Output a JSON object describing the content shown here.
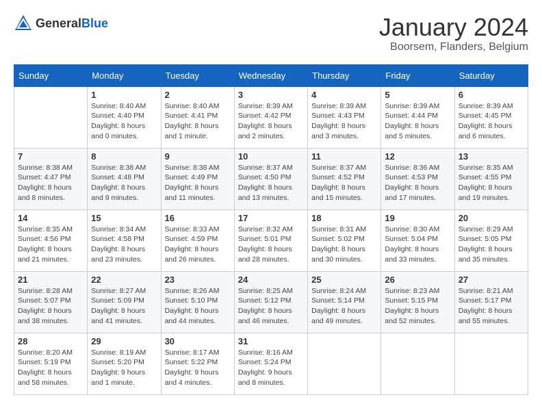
{
  "header": {
    "logo_general": "General",
    "logo_blue": "Blue",
    "month_title": "January 2024",
    "location": "Boorsem, Flanders, Belgium"
  },
  "weekdays": [
    "Sunday",
    "Monday",
    "Tuesday",
    "Wednesday",
    "Thursday",
    "Friday",
    "Saturday"
  ],
  "weeks": [
    [
      {
        "day": "",
        "info": ""
      },
      {
        "day": "1",
        "info": "Sunrise: 8:40 AM\nSunset: 4:40 PM\nDaylight: 8 hours\nand 0 minutes."
      },
      {
        "day": "2",
        "info": "Sunrise: 8:40 AM\nSunset: 4:41 PM\nDaylight: 8 hours\nand 1 minute."
      },
      {
        "day": "3",
        "info": "Sunrise: 8:39 AM\nSunset: 4:42 PM\nDaylight: 8 hours\nand 2 minutes."
      },
      {
        "day": "4",
        "info": "Sunrise: 8:39 AM\nSunset: 4:43 PM\nDaylight: 8 hours\nand 3 minutes."
      },
      {
        "day": "5",
        "info": "Sunrise: 8:39 AM\nSunset: 4:44 PM\nDaylight: 8 hours\nand 5 minutes."
      },
      {
        "day": "6",
        "info": "Sunrise: 8:39 AM\nSunset: 4:45 PM\nDaylight: 8 hours\nand 6 minutes."
      }
    ],
    [
      {
        "day": "7",
        "info": "Sunrise: 8:38 AM\nSunset: 4:47 PM\nDaylight: 8 hours\nand 8 minutes."
      },
      {
        "day": "8",
        "info": "Sunrise: 8:38 AM\nSunset: 4:48 PM\nDaylight: 8 hours\nand 9 minutes."
      },
      {
        "day": "9",
        "info": "Sunrise: 8:38 AM\nSunset: 4:49 PM\nDaylight: 8 hours\nand 11 minutes."
      },
      {
        "day": "10",
        "info": "Sunrise: 8:37 AM\nSunset: 4:50 PM\nDaylight: 8 hours\nand 13 minutes."
      },
      {
        "day": "11",
        "info": "Sunrise: 8:37 AM\nSunset: 4:52 PM\nDaylight: 8 hours\nand 15 minutes."
      },
      {
        "day": "12",
        "info": "Sunrise: 8:36 AM\nSunset: 4:53 PM\nDaylight: 8 hours\nand 17 minutes."
      },
      {
        "day": "13",
        "info": "Sunrise: 8:35 AM\nSunset: 4:55 PM\nDaylight: 8 hours\nand 19 minutes."
      }
    ],
    [
      {
        "day": "14",
        "info": "Sunrise: 8:35 AM\nSunset: 4:56 PM\nDaylight: 8 hours\nand 21 minutes."
      },
      {
        "day": "15",
        "info": "Sunrise: 8:34 AM\nSunset: 4:58 PM\nDaylight: 8 hours\nand 23 minutes."
      },
      {
        "day": "16",
        "info": "Sunrise: 8:33 AM\nSunset: 4:59 PM\nDaylight: 8 hours\nand 26 minutes."
      },
      {
        "day": "17",
        "info": "Sunrise: 8:32 AM\nSunset: 5:01 PM\nDaylight: 8 hours\nand 28 minutes."
      },
      {
        "day": "18",
        "info": "Sunrise: 8:31 AM\nSunset: 5:02 PM\nDaylight: 8 hours\nand 30 minutes."
      },
      {
        "day": "19",
        "info": "Sunrise: 8:30 AM\nSunset: 5:04 PM\nDaylight: 8 hours\nand 33 minutes."
      },
      {
        "day": "20",
        "info": "Sunrise: 8:29 AM\nSunset: 5:05 PM\nDaylight: 8 hours\nand 35 minutes."
      }
    ],
    [
      {
        "day": "21",
        "info": "Sunrise: 8:28 AM\nSunset: 5:07 PM\nDaylight: 8 hours\nand 38 minutes."
      },
      {
        "day": "22",
        "info": "Sunrise: 8:27 AM\nSunset: 5:09 PM\nDaylight: 8 hours\nand 41 minutes."
      },
      {
        "day": "23",
        "info": "Sunrise: 8:26 AM\nSunset: 5:10 PM\nDaylight: 8 hours\nand 44 minutes."
      },
      {
        "day": "24",
        "info": "Sunrise: 8:25 AM\nSunset: 5:12 PM\nDaylight: 8 hours\nand 46 minutes."
      },
      {
        "day": "25",
        "info": "Sunrise: 8:24 AM\nSunset: 5:14 PM\nDaylight: 8 hours\nand 49 minutes."
      },
      {
        "day": "26",
        "info": "Sunrise: 8:23 AM\nSunset: 5:15 PM\nDaylight: 8 hours\nand 52 minutes."
      },
      {
        "day": "27",
        "info": "Sunrise: 8:21 AM\nSunset: 5:17 PM\nDaylight: 8 hours\nand 55 minutes."
      }
    ],
    [
      {
        "day": "28",
        "info": "Sunrise: 8:20 AM\nSunset: 5:19 PM\nDaylight: 8 hours\nand 58 minutes."
      },
      {
        "day": "29",
        "info": "Sunrise: 8:19 AM\nSunset: 5:20 PM\nDaylight: 9 hours\nand 1 minute."
      },
      {
        "day": "30",
        "info": "Sunrise: 8:17 AM\nSunset: 5:22 PM\nDaylight: 9 hours\nand 4 minutes."
      },
      {
        "day": "31",
        "info": "Sunrise: 8:16 AM\nSunset: 5:24 PM\nDaylight: 9 hours\nand 8 minutes."
      },
      {
        "day": "",
        "info": ""
      },
      {
        "day": "",
        "info": ""
      },
      {
        "day": "",
        "info": ""
      }
    ]
  ]
}
